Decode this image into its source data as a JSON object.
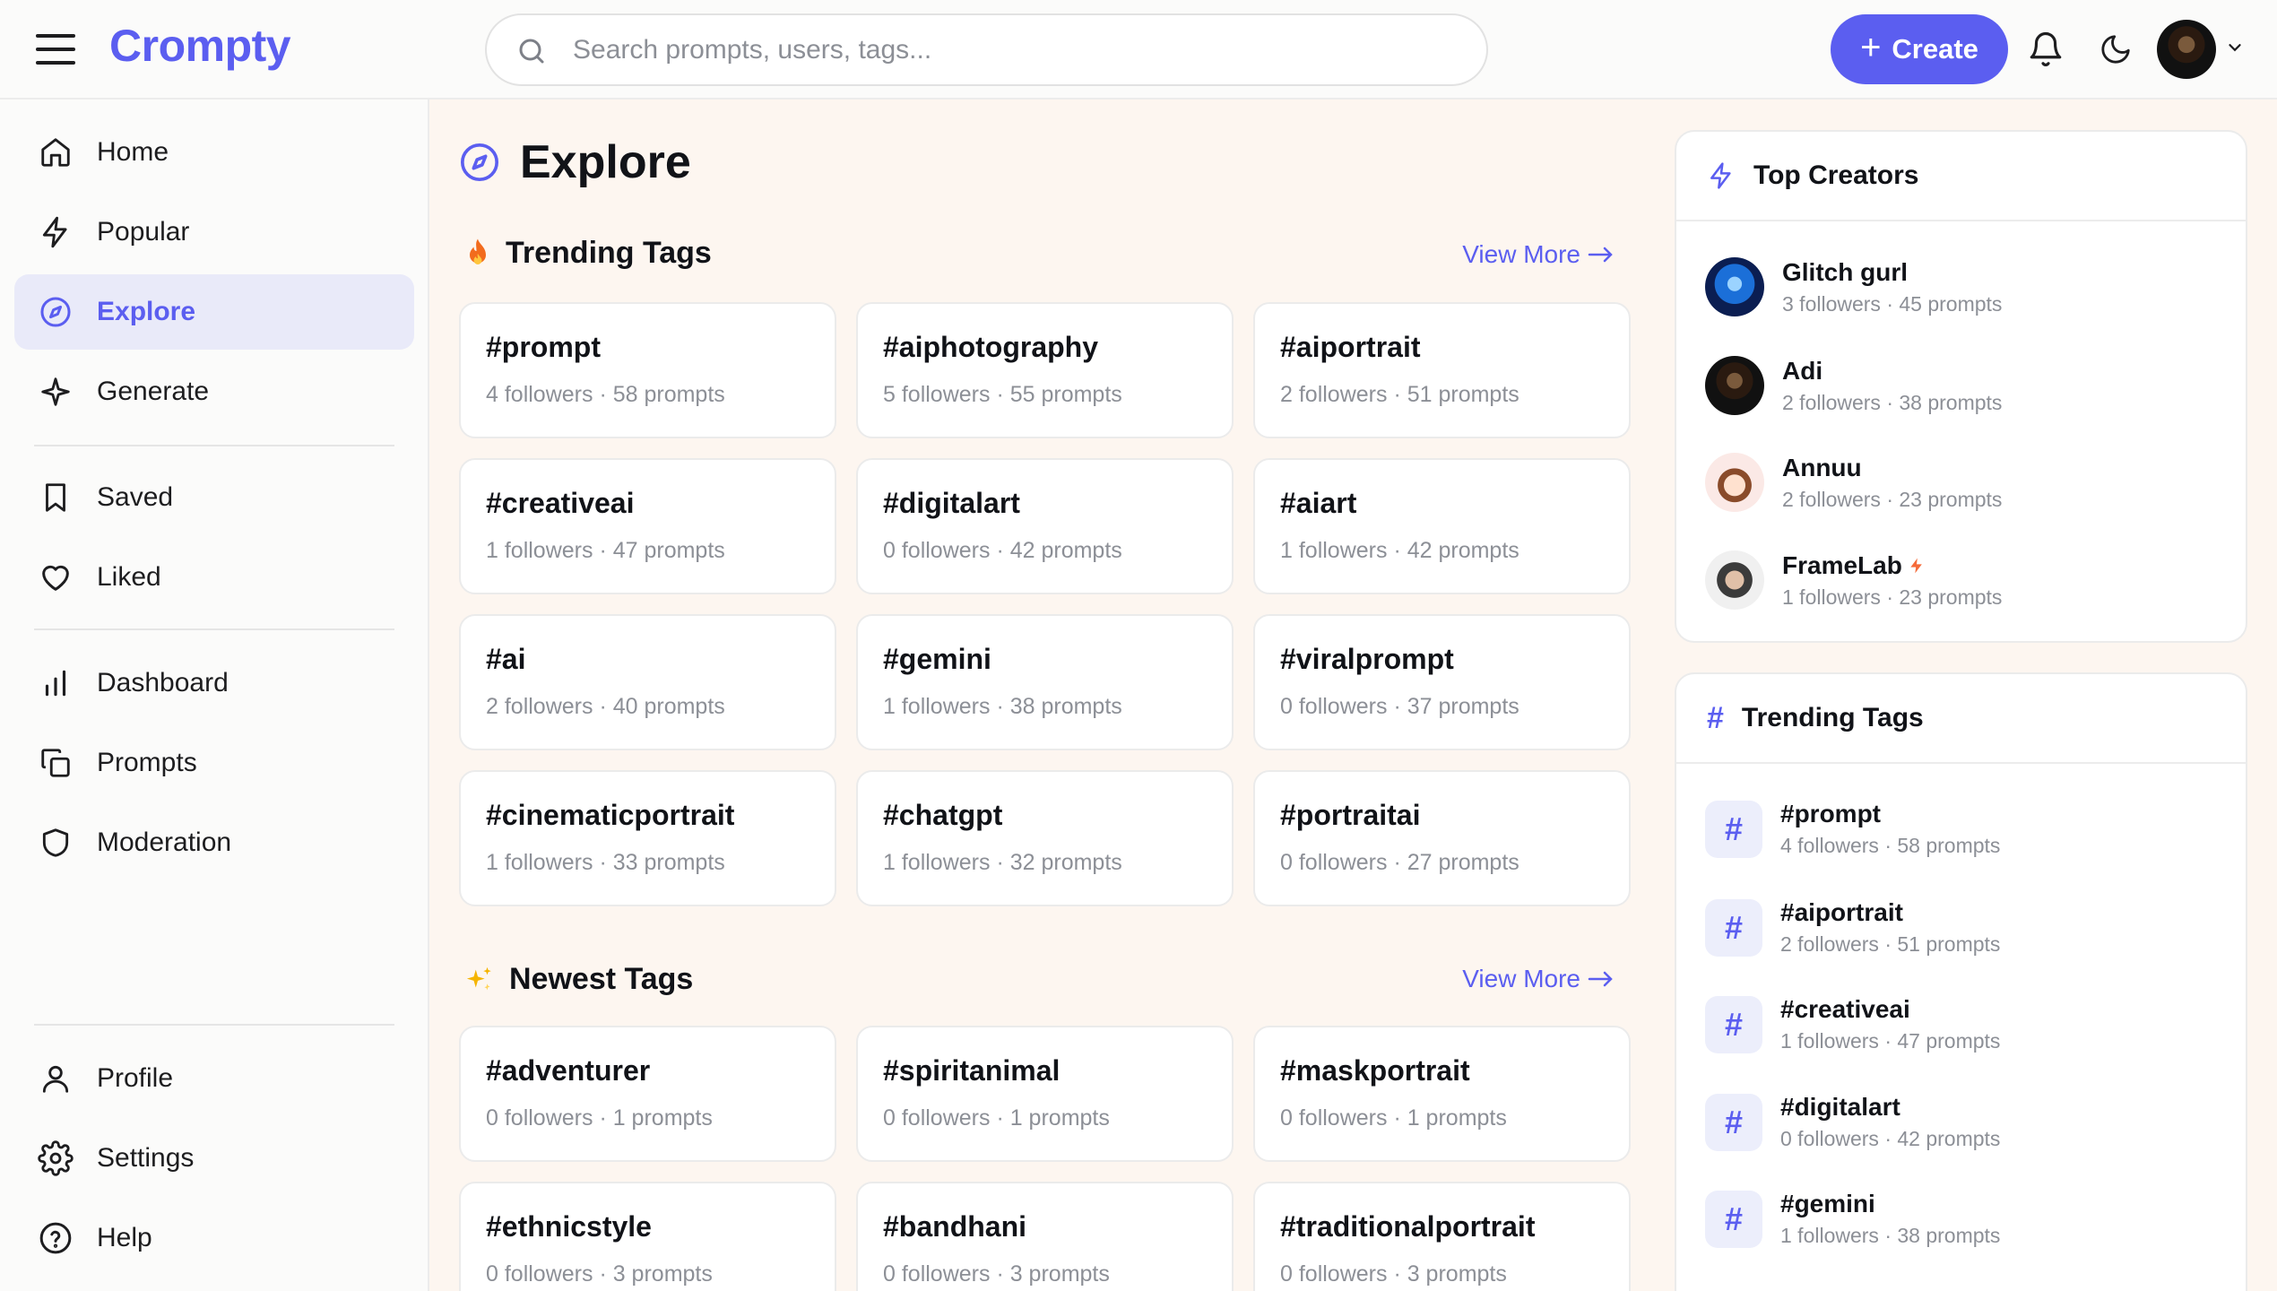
{
  "header": {
    "logo": "Crompty",
    "search_placeholder": "Search prompts, users, tags...",
    "create_label": "Create"
  },
  "sidebar": {
    "items": [
      {
        "label": "Home",
        "icon": "home-icon"
      },
      {
        "label": "Popular",
        "icon": "bolt-icon"
      },
      {
        "label": "Explore",
        "icon": "compass-icon",
        "active": true
      },
      {
        "label": "Generate",
        "icon": "sparkle-icon"
      },
      {
        "label": "Saved",
        "icon": "bookmark-icon"
      },
      {
        "label": "Liked",
        "icon": "heart-icon"
      },
      {
        "label": "Dashboard",
        "icon": "bar-chart-icon"
      },
      {
        "label": "Prompts",
        "icon": "copy-icon"
      },
      {
        "label": "Moderation",
        "icon": "shield-icon"
      },
      {
        "label": "Profile",
        "icon": "user-icon"
      },
      {
        "label": "Settings",
        "icon": "gear-icon"
      },
      {
        "label": "Help",
        "icon": "help-icon"
      }
    ]
  },
  "main": {
    "title": "Explore",
    "trending": {
      "title": "Trending Tags",
      "view_more": "View More",
      "cards": [
        {
          "tag": "#prompt",
          "meta": "4 followers · 58 prompts"
        },
        {
          "tag": "#aiphotography",
          "meta": "5 followers · 55 prompts"
        },
        {
          "tag": "#aiportrait",
          "meta": "2 followers · 51 prompts"
        },
        {
          "tag": "#creativeai",
          "meta": "1 followers · 47 prompts"
        },
        {
          "tag": "#digitalart",
          "meta": "0 followers · 42 prompts"
        },
        {
          "tag": "#aiart",
          "meta": "1 followers · 42 prompts"
        },
        {
          "tag": "#ai",
          "meta": "2 followers · 40 prompts"
        },
        {
          "tag": "#gemini",
          "meta": "1 followers · 38 prompts"
        },
        {
          "tag": "#viralprompt",
          "meta": "0 followers · 37 prompts"
        },
        {
          "tag": "#cinematicportrait",
          "meta": "1 followers · 33 prompts"
        },
        {
          "tag": "#chatgpt",
          "meta": "1 followers · 32 prompts"
        },
        {
          "tag": "#portraitai",
          "meta": "0 followers · 27 prompts"
        }
      ]
    },
    "newest": {
      "title": "Newest Tags",
      "view_more": "View More",
      "cards": [
        {
          "tag": "#adventurer",
          "meta": "0 followers · 1 prompts"
        },
        {
          "tag": "#spiritanimal",
          "meta": "0 followers · 1 prompts"
        },
        {
          "tag": "#maskportrait",
          "meta": "0 followers · 1 prompts"
        },
        {
          "tag": "#ethnicstyle",
          "meta": "0 followers · 3 prompts"
        },
        {
          "tag": "#bandhani",
          "meta": "0 followers · 3 prompts"
        },
        {
          "tag": "#traditionalportrait",
          "meta": "0 followers · 3 prompts"
        }
      ]
    }
  },
  "right": {
    "top_creators": {
      "title": "Top Creators",
      "items": [
        {
          "name": "Glitch gurl",
          "meta": "3 followers · 45 prompts"
        },
        {
          "name": "Adi",
          "meta": "2 followers · 38 prompts"
        },
        {
          "name": "Annuu",
          "meta": "2 followers · 23 prompts"
        },
        {
          "name": "FrameLab",
          "meta": "1 followers · 23 prompts",
          "badge": "bolt-icon"
        }
      ]
    },
    "trending_tags": {
      "title": "Trending Tags",
      "items": [
        {
          "name": "#prompt",
          "meta": "4 followers · 58 prompts"
        },
        {
          "name": "#aiportrait",
          "meta": "2 followers · 51 prompts"
        },
        {
          "name": "#creativeai",
          "meta": "1 followers · 47 prompts"
        },
        {
          "name": "#digitalart",
          "meta": "0 followers · 42 prompts"
        },
        {
          "name": "#gemini",
          "meta": "1 followers · 38 prompts"
        }
      ]
    }
  },
  "colors": {
    "accent": "#5b5ef0",
    "background": "#fdf6f0",
    "muted_text": "#8c8f96"
  }
}
